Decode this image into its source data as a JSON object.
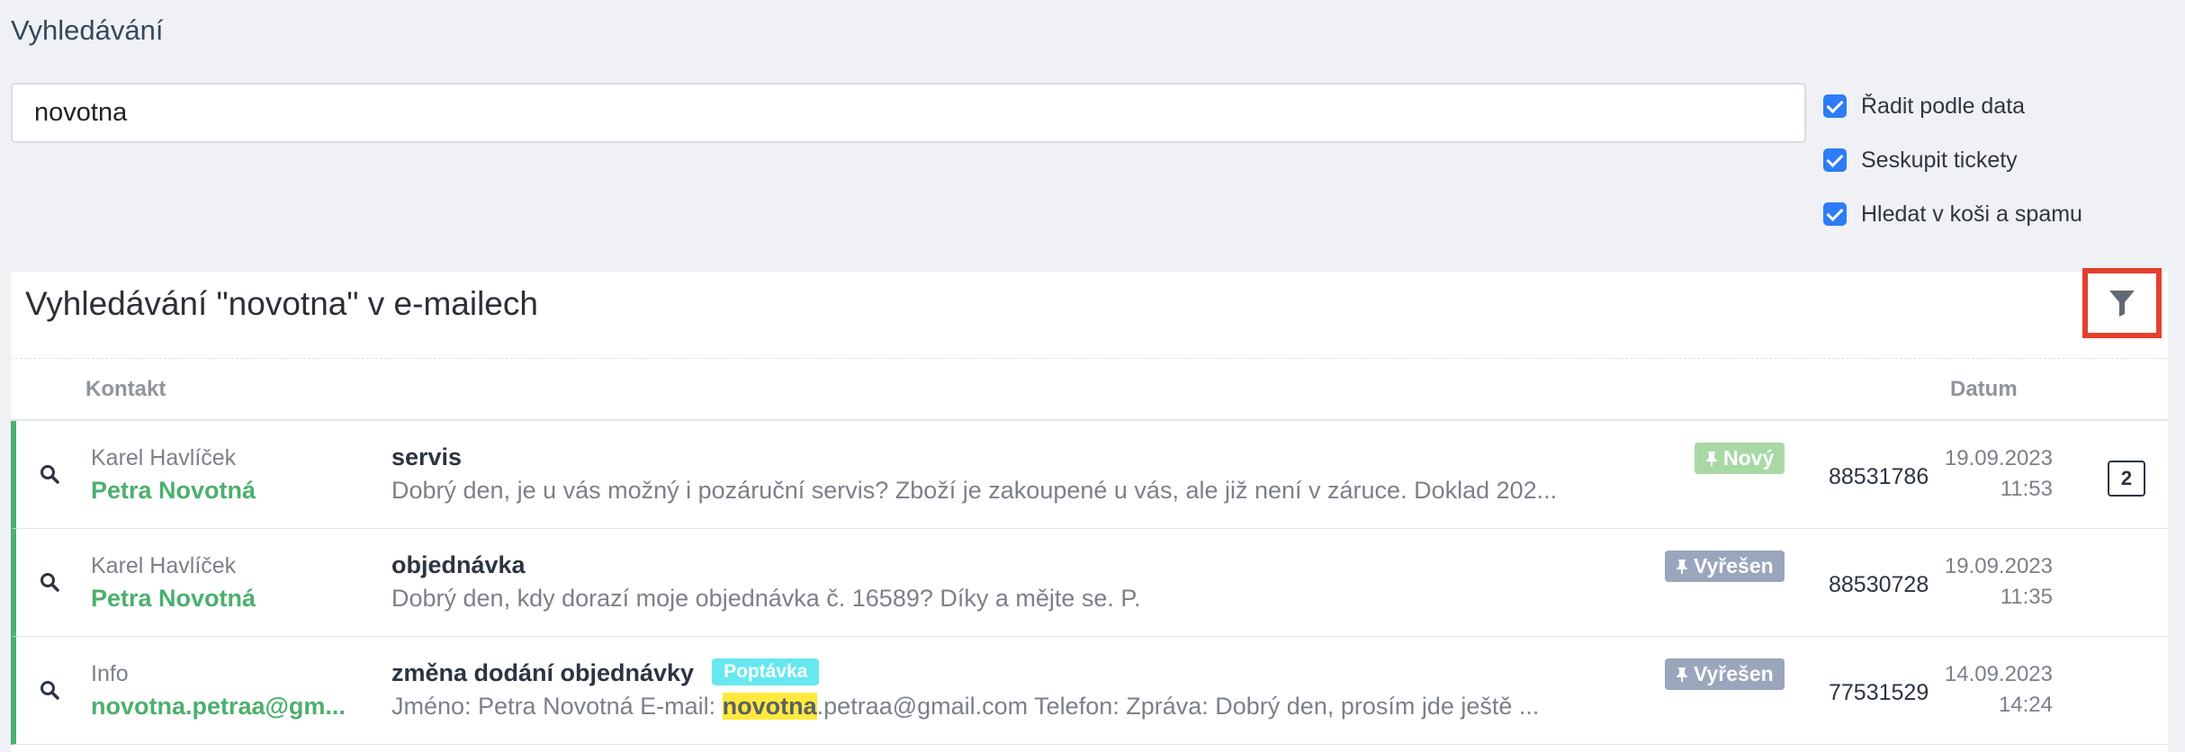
{
  "page": {
    "heading": "Vyhledávání"
  },
  "search": {
    "value": "novotna"
  },
  "options": [
    {
      "label": "Řadit podle data",
      "checked": true
    },
    {
      "label": "Seskupit tickety",
      "checked": true
    },
    {
      "label": "Hledat v koši a spamu",
      "checked": true
    }
  ],
  "results": {
    "title": "Vyhledávání \"novotna\" v e-mailech",
    "filter_icon": "filter-icon",
    "columns": {
      "contact": "Kontakt",
      "date": "Datum"
    },
    "rows": [
      {
        "contact_name": "Karel Havlíček",
        "contact_sub": "Petra Novotná",
        "subject": "servis",
        "snippet": "Dobrý den, je u vás možný i pozáruční servis? Zboží je zakoupené u vás, ale již není v záruce. Doklad 202...",
        "status": "Nový",
        "ticket_id": "88531786",
        "date": "19.09.2023",
        "time": "11:53",
        "count": "2"
      },
      {
        "contact_name": "Karel Havlíček",
        "contact_sub": "Petra Novotná",
        "subject": "objednávka",
        "snippet": "Dobrý den, kdy dorazí moje objednávka č. 16589? Díky a mějte se. P.",
        "status": "Vyřešen",
        "ticket_id": "88530728",
        "date": "19.09.2023",
        "time": "11:35"
      },
      {
        "contact_name": "Info",
        "contact_sub": "novotna.petraa@gm...",
        "subject": "změna dodání objednávky",
        "tag": "Poptávka",
        "snippet_pre": "Jméno: Petra Novotná E-mail: ",
        "snippet_hl": "novotna",
        "snippet_post": ".petraa@gmail.com Telefon: Zpráva: Dobrý den, prosím jde ještě ...",
        "status": "Vyřešen",
        "ticket_id": "77531529",
        "date": "14.09.2023",
        "time": "14:24"
      }
    ]
  },
  "colors": {
    "accent_green": "#4caf6d",
    "checkbox_blue": "#2e7cf6",
    "status_new": "#a8d9a5",
    "status_resolved": "#99a6bc",
    "tag_cyan": "#66e8f0",
    "highlight": "#ffe93d",
    "focus_red": "#e53f2e"
  }
}
